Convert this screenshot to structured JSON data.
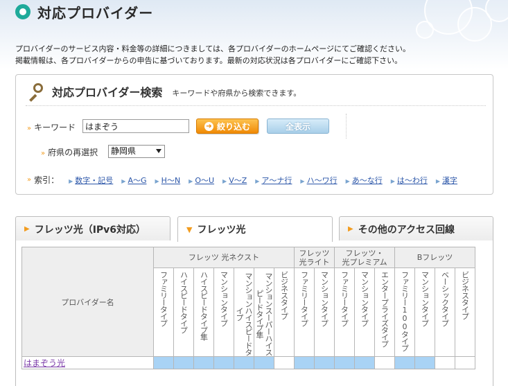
{
  "page": {
    "title": "対応プロバイダー",
    "intro_line1": "プロバイダーのサービス内容・料金等の詳細につきましては、各プロバイダーのホームページにてご確認ください。",
    "intro_line2": "掲載情報は、各プロバイダーからの申告に基づいております。最新の対応状況は各プロバイダーにご確認下さい。"
  },
  "search": {
    "title": "対応プロバイダー検索",
    "subtitle": "キーワードや府県から検索できます。",
    "keyword_label": "キーワード",
    "keyword_value": "はまぞう",
    "narrow_button": "絞り込む",
    "show_all_button": "全表示",
    "prefecture_label": "府県の再選択",
    "prefecture_value": "静岡県",
    "index_label": "索引：",
    "index_links": [
      "数字・記号",
      "A〜G",
      "H〜N",
      "O〜U",
      "V〜Z",
      "ア〜ナ行",
      "ハ〜ワ行",
      "あ〜な行",
      "は〜わ行",
      "漢字"
    ]
  },
  "tabs": [
    {
      "label": "フレッツ光（IPv6対応）",
      "active": false
    },
    {
      "label": "フレッツ光",
      "active": true
    },
    {
      "label": "その他のアクセス回線",
      "active": false
    }
  ],
  "table": {
    "provider_header": "プロバイダー名",
    "groups": [
      {
        "name": "フレッツ 光ネクスト",
        "columns": [
          "ファミリータイプ",
          "ハイスピードタイプ",
          "ハイスピードタイプ隼",
          "マンションタイプ",
          "マンションハイスピードタイプ",
          "マンションスーパーハイスピードタイプ隼",
          "ビジネスタイプ"
        ]
      },
      {
        "name_line1": "フレッツ",
        "name_line2": "光ライト",
        "columns": [
          "ファミリータイプ",
          "マンションタイプ"
        ]
      },
      {
        "name_line1": "フレッツ・",
        "name_line2": "光プレミアム",
        "columns": [
          "ファミリータイプ",
          "マンションタイプ",
          "エンタープライズタイプ"
        ]
      },
      {
        "name": "Bフレッツ",
        "columns": [
          "ファミリー100タイプ",
          "マンションタイプ",
          "ベーシックタイプ",
          "ビジネスタイプ"
        ]
      }
    ],
    "rows": [
      {
        "provider": "はまぞう光",
        "support": [
          true,
          true,
          true,
          true,
          true,
          true,
          false,
          true,
          true,
          true,
          true,
          false,
          true,
          true,
          false,
          false
        ]
      }
    ]
  },
  "colors": {
    "accent_teal": "#1eaa9a",
    "orange": "#f08a06",
    "supported_cell": "#a9d3f5",
    "link": "#2a55a8"
  },
  "icons": [
    "ring-icon",
    "magnifier-icon",
    "chevron-right-icon",
    "arrow-right-icon",
    "dropdown-caret-icon",
    "triangle-right-icon"
  ]
}
